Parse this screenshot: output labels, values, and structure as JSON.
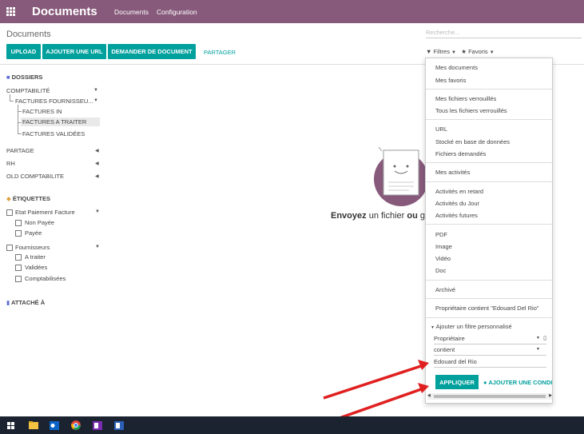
{
  "header": {
    "app_title": "Documents",
    "menu": [
      "Documents",
      "Configuration"
    ]
  },
  "control_panel": {
    "breadcrumb": "Documents",
    "buttons": [
      "UPLOAD",
      "AJOUTER UNE URL",
      "DEMANDER DE DOCUMENT"
    ],
    "share_label": "PARTAGER",
    "search_placeholder": "Recherche...",
    "filters_label": "Filtres",
    "favorites_label": "Favoris"
  },
  "sidebar": {
    "folders_title": "DOSSIERS",
    "folders": {
      "comptabilite": "COMPTABILITÉ",
      "factures_fournisseurs": "FACTURES FOURNISSEU...",
      "factures_in": "FACTURES IN",
      "factures_a_traiter": "FACTURES A TRAITER",
      "factures_validees": "FACTURES VALIDÉES",
      "partage": "PARTAGE",
      "rh": "RH",
      "old_comptabilite": "OLD COMPTABILITE"
    },
    "tags_title": "ÉTIQUETTES",
    "tags": {
      "etat_paiement": "Etat Paiement Facture",
      "non_payee": "Non Payée",
      "payee": "Payée",
      "fournisseurs": "Fournisseurs",
      "a_traiter": "A traiter",
      "validees": "Validées",
      "comptabilisees": "Comptabilisées"
    },
    "attached_title": "ATTACHÉ À"
  },
  "main": {
    "helper_strong": "Envoyez",
    "helper_rest": " un fichier ",
    "helper_strong2": "ou",
    "helper_tail": " gl"
  },
  "filters_dropdown": {
    "items": {
      "mes_documents": "Mes documents",
      "mes_favoris": "Mes favoris",
      "mes_fichiers_verrouilles": "Mes fichiers verrouillés",
      "tous_fichiers_verrouilles": "Tous les fichiers verrouillés",
      "url": "URL",
      "stocke_bd": "Stocké en base de données",
      "fichiers_demandes": "Fichiers demandés",
      "mes_activites": "Mes activités",
      "activites_retard": "Activités en retard",
      "activites_jour": "Activités du Jour",
      "activites_futures": "Activités futures",
      "pdf": "PDF",
      "image": "Image",
      "video": "Vidéo",
      "doc": "Doc",
      "archive": "Archivé",
      "proprietaire_contient": "Propriétaire contient \"Edouard Del Rio\""
    },
    "custom_filter_label": "Ajouter un filtre personnalisé",
    "field_value": "Propriétaire",
    "operator_value": "contient",
    "value_value": "Edouard del Rio",
    "apply_label": "APPLIQUER",
    "add_condition_label": "AJOUTER UNE CONDI"
  },
  "colors": {
    "brand": "#875a7b",
    "accent": "#00a09d",
    "arrow": "#e02020",
    "taskbar": "#1c2330"
  },
  "taskbar_icons": [
    "windows-icon",
    "file-explorer-icon",
    "outlook-icon",
    "chrome-icon",
    "onenote-icon",
    "word-icon"
  ]
}
